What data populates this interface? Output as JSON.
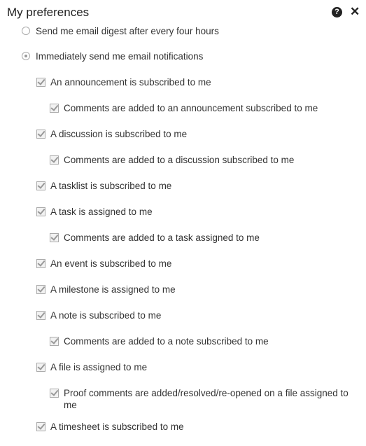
{
  "header": {
    "title": "My preferences",
    "help_icon": "?",
    "close_icon": "✕"
  },
  "radios": [
    {
      "label": "Send me email digest after every four hours",
      "checked": false
    },
    {
      "label": "Immediately send me email notifications",
      "checked": true
    }
  ],
  "options": [
    {
      "label": "An announcement is subscribed to me",
      "level": 1,
      "checked": true
    },
    {
      "label": "Comments are added to an announcement subscribed to me",
      "level": 2,
      "checked": true
    },
    {
      "label": "A discussion is subscribed to me",
      "level": 1,
      "checked": true
    },
    {
      "label": "Comments are added to a discussion subscribed to me",
      "level": 2,
      "checked": true
    },
    {
      "label": "A tasklist is subscribed to me",
      "level": 1,
      "checked": true
    },
    {
      "label": "A task is assigned to me",
      "level": 1,
      "checked": true
    },
    {
      "label": "Comments are added to a task assigned to me",
      "level": 2,
      "checked": true
    },
    {
      "label": "An event is subscribed to me",
      "level": 1,
      "checked": true
    },
    {
      "label": "A milestone is assigned to me",
      "level": 1,
      "checked": true
    },
    {
      "label": "A note is subscribed to me",
      "level": 1,
      "checked": true
    },
    {
      "label": "Comments are added to a note subscribed to me",
      "level": 2,
      "checked": true
    },
    {
      "label": "A file is assigned to me",
      "level": 1,
      "checked": true
    },
    {
      "label": "Proof comments are added/resolved/re-opened on a file assigned to me",
      "level": 2,
      "checked": true
    },
    {
      "label": "A timesheet is subscribed to me",
      "level": 1,
      "checked": true
    }
  ]
}
